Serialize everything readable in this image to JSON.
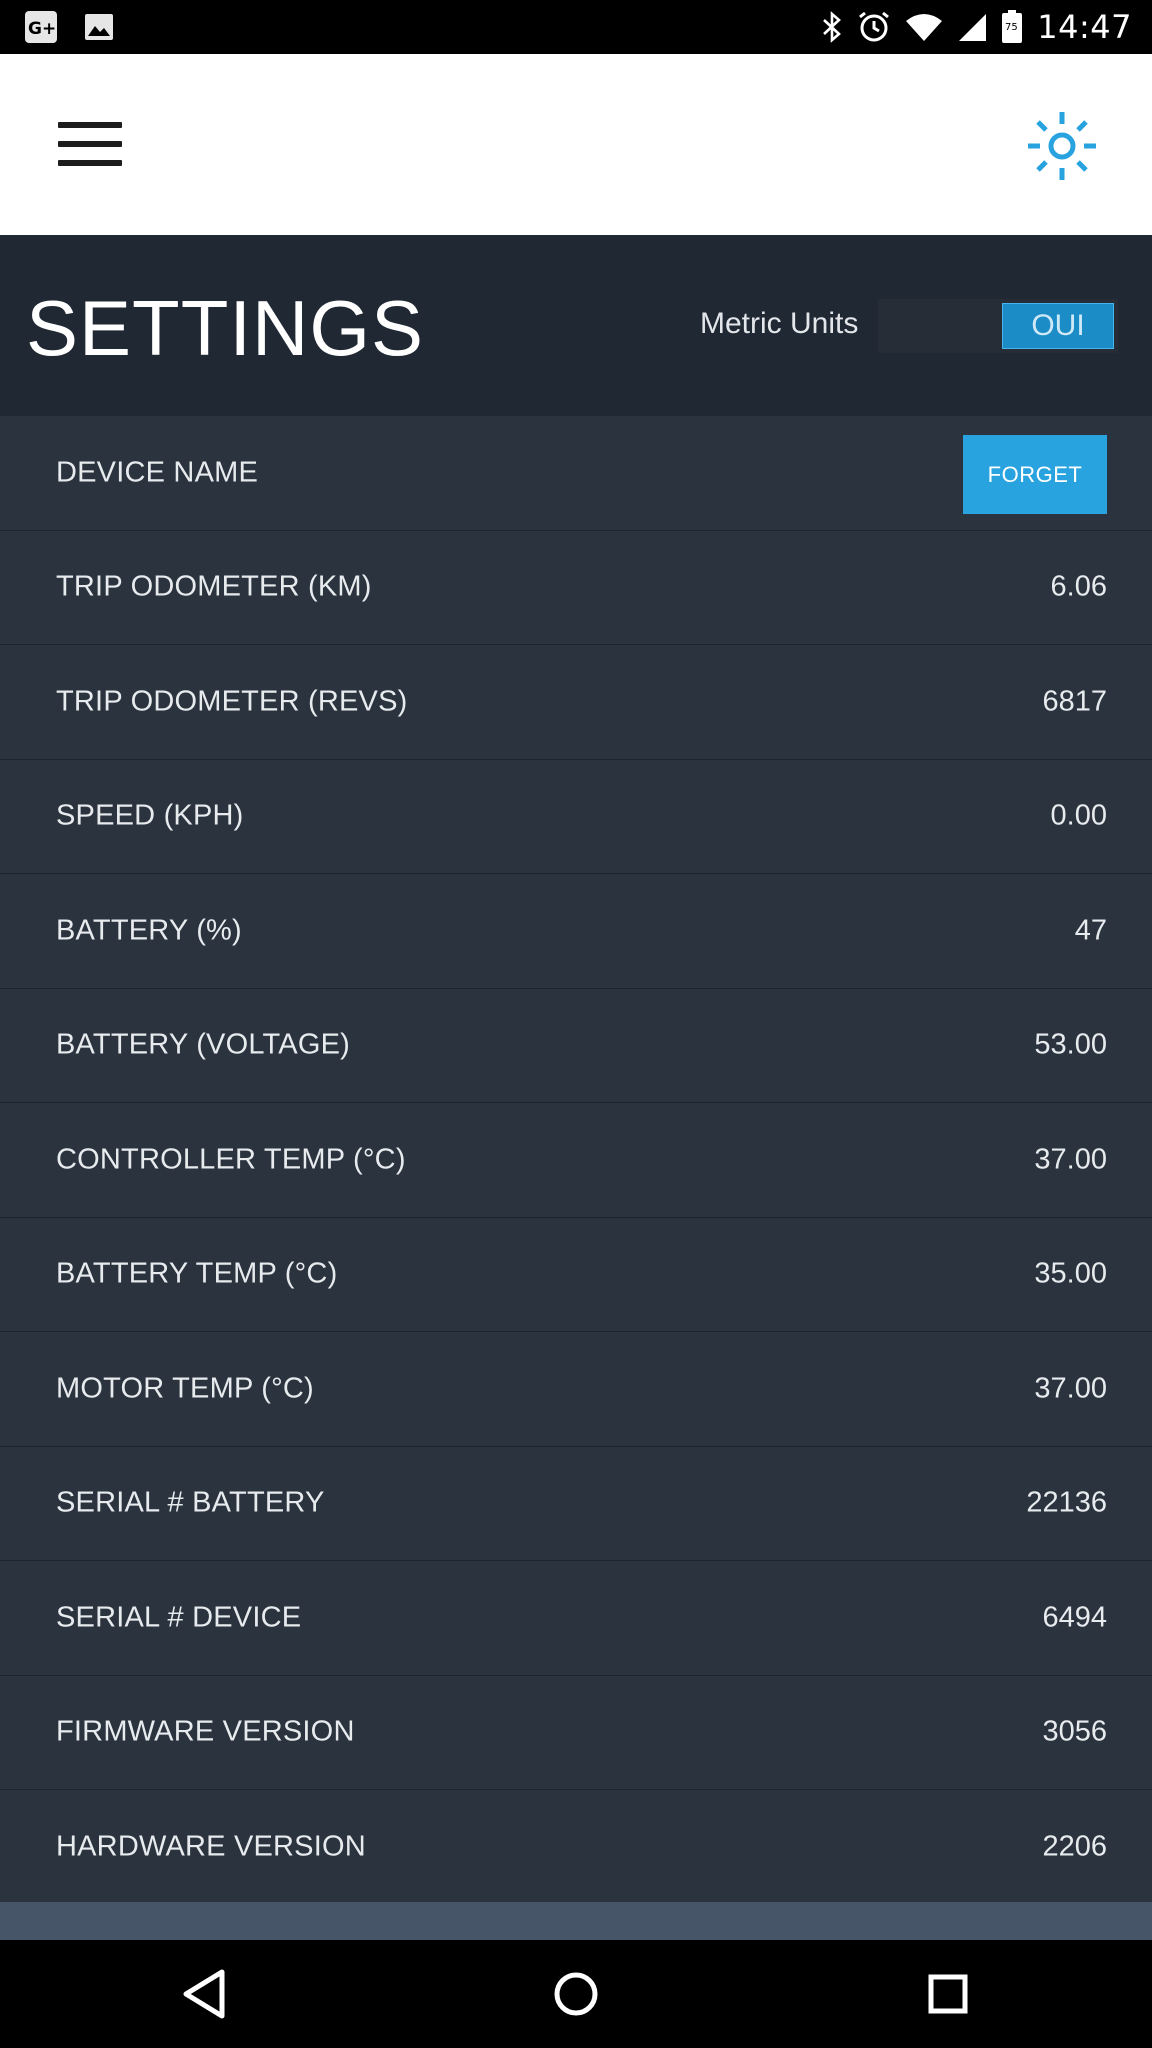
{
  "status_bar": {
    "time": "14:47",
    "icons": [
      "google-plus-icon",
      "image-icon",
      "bluetooth-icon",
      "alarm-icon",
      "wifi-icon",
      "signal-icon",
      "battery-icon"
    ],
    "battery_level_text": "75"
  },
  "app_bar": {
    "menu_icon": "hamburger-menu-icon",
    "action_icon": "brightness-icon",
    "accent_color": "#29a3df"
  },
  "header": {
    "title": "SETTINGS",
    "metric_units_label": "Metric Units",
    "metric_units_toggle": "OUI",
    "metric_units_on": true
  },
  "settings": [
    {
      "label": "DEVICE NAME",
      "action": "FORGET"
    },
    {
      "label": "TRIP ODOMETER (KM)",
      "value": "6.06"
    },
    {
      "label": "TRIP ODOMETER (REVS)",
      "value": "6817"
    },
    {
      "label": "SPEED (KPH)",
      "value": "0.00"
    },
    {
      "label": "BATTERY (%)",
      "value": "47"
    },
    {
      "label": "BATTERY (VOLTAGE)",
      "value": "53.00"
    },
    {
      "label": "CONTROLLER TEMP (°C)",
      "value": "37.00"
    },
    {
      "label": "BATTERY TEMP (°C)",
      "value": "35.00"
    },
    {
      "label": "MOTOR TEMP (°C)",
      "value": "37.00"
    },
    {
      "label": "SERIAL # BATTERY",
      "value": "22136"
    },
    {
      "label": "SERIAL # DEVICE",
      "value": "6494"
    },
    {
      "label": "FIRMWARE VERSION",
      "value": "3056"
    },
    {
      "label": "HARDWARE VERSION",
      "value": "2206"
    }
  ],
  "nav_bar": {
    "buttons": [
      "back-icon",
      "home-icon",
      "recents-icon"
    ]
  }
}
